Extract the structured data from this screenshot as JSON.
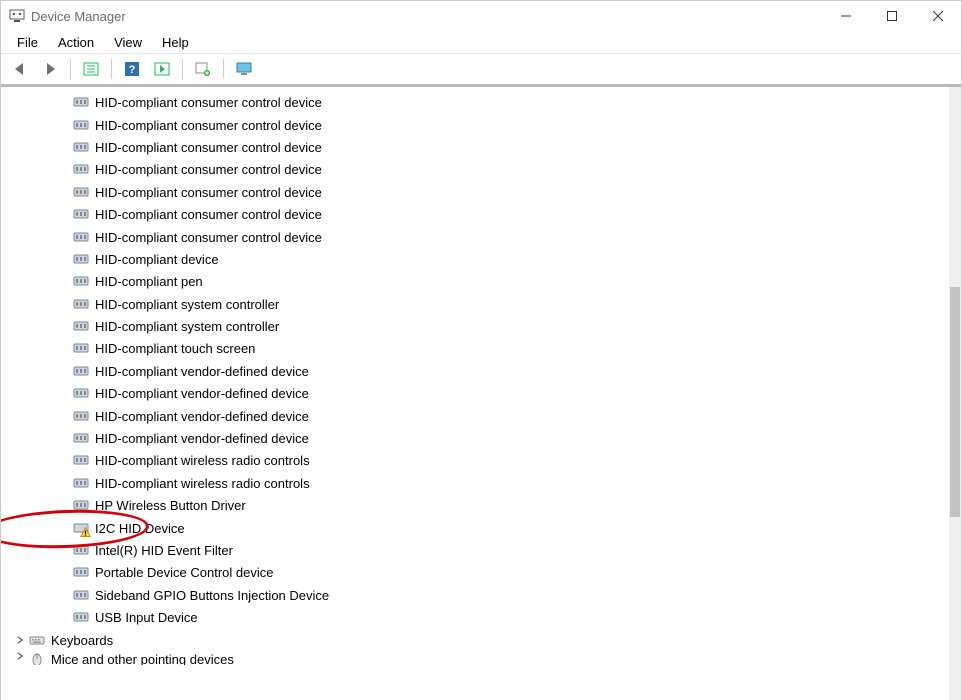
{
  "window": {
    "title": "Device Manager"
  },
  "menus": {
    "file": "File",
    "action": "Action",
    "view": "View",
    "help": "Help"
  },
  "toolbar_icons": {
    "back": "back-arrow-icon",
    "forward": "forward-arrow-icon",
    "show_hidden": "show-hidden-icon",
    "help": "help-icon",
    "action": "action-icon",
    "scan": "scan-hardware-icon",
    "monitor": "monitor-icon"
  },
  "devices": {
    "hid_children": [
      "HID-compliant consumer control device",
      "HID-compliant consumer control device",
      "HID-compliant consumer control device",
      "HID-compliant consumer control device",
      "HID-compliant consumer control device",
      "HID-compliant consumer control device",
      "HID-compliant consumer control device",
      "HID-compliant device",
      "HID-compliant pen",
      "HID-compliant system controller",
      "HID-compliant system controller",
      "HID-compliant touch screen",
      "HID-compliant vendor-defined device",
      "HID-compliant vendor-defined device",
      "HID-compliant vendor-defined device",
      "HID-compliant vendor-defined device",
      "HID-compliant wireless radio controls",
      "HID-compliant wireless radio controls",
      "HP Wireless Button Driver",
      "I2C HID Device",
      "Intel(R) HID Event Filter",
      "Portable Device Control device",
      "Sideband GPIO Buttons Injection Device",
      "USB Input Device"
    ],
    "warning_index": 19,
    "circled_index": 19,
    "categories_after": [
      {
        "name": "Keyboards",
        "expandable": true,
        "icon": "keyboard"
      },
      {
        "name": "Mice and other pointing devices",
        "expandable": true,
        "icon": "mouse",
        "cutoff": true
      }
    ]
  }
}
